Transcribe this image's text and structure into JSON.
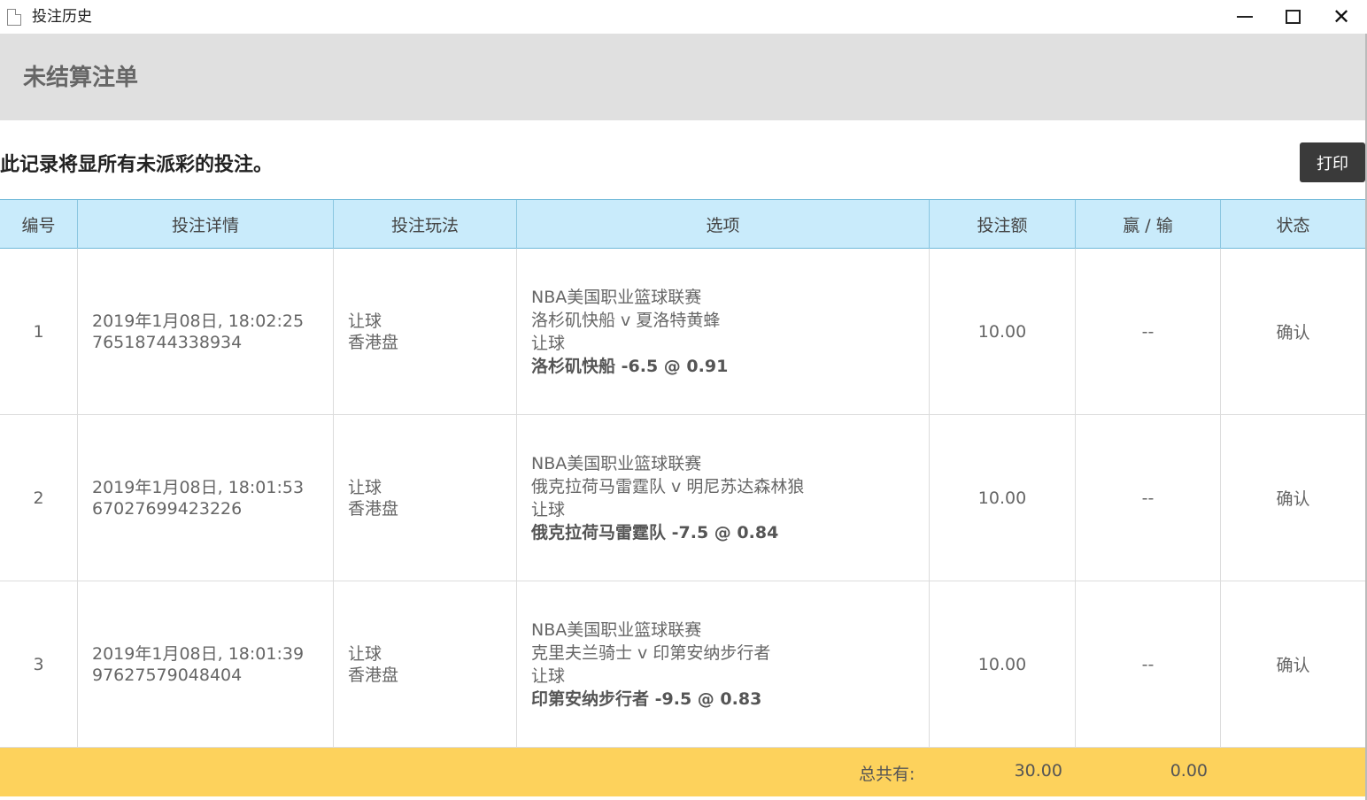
{
  "window": {
    "title": "投注历史"
  },
  "section": {
    "title": "未结算注单",
    "note": "此记录将显所有未派彩的投注。",
    "print_label": "打印"
  },
  "table": {
    "headers": [
      "编号",
      "投注详情",
      "投注玩法",
      "选项",
      "投注额",
      "赢 / 输",
      "状态"
    ],
    "rows": [
      {
        "no": "1",
        "datetime": "2019年1月08日, 18:02:25",
        "bet_id": "76518744338934",
        "bet_type": "让球",
        "odds_type": "香港盘",
        "league": "NBA美国职业篮球联赛",
        "match": "洛杉矶快船 v 夏洛特黄蜂",
        "market": "让球",
        "pick_team": "洛杉矶快船",
        "pick_line": "-6.5 @ 0.91",
        "stake": "10.00",
        "win_loss": "--",
        "status": "确认"
      },
      {
        "no": "2",
        "datetime": "2019年1月08日, 18:01:53",
        "bet_id": "67027699423226",
        "bet_type": "让球",
        "odds_type": "香港盘",
        "league": "NBA美国职业篮球联赛",
        "match": "俄克拉荷马雷霆队 v 明尼苏达森林狼",
        "market": "让球",
        "pick_team": "俄克拉荷马雷霆队",
        "pick_line": "-7.5 @ 0.84",
        "stake": "10.00",
        "win_loss": "--",
        "status": "确认"
      },
      {
        "no": "3",
        "datetime": "2019年1月08日, 18:01:39",
        "bet_id": "97627579048404",
        "bet_type": "让球",
        "odds_type": "香港盘",
        "league": "NBA美国职业篮球联赛",
        "match": "克里夫兰骑士 v 印第安纳步行者",
        "market": "让球",
        "pick_team": "印第安纳步行者",
        "pick_line": "-9.5 @ 0.83",
        "stake": "10.00",
        "win_loss": "--",
        "status": "确认"
      }
    ]
  },
  "footer": {
    "total_label": "总共有:",
    "total_stake": "30.00",
    "total_win_loss": "0.00"
  }
}
